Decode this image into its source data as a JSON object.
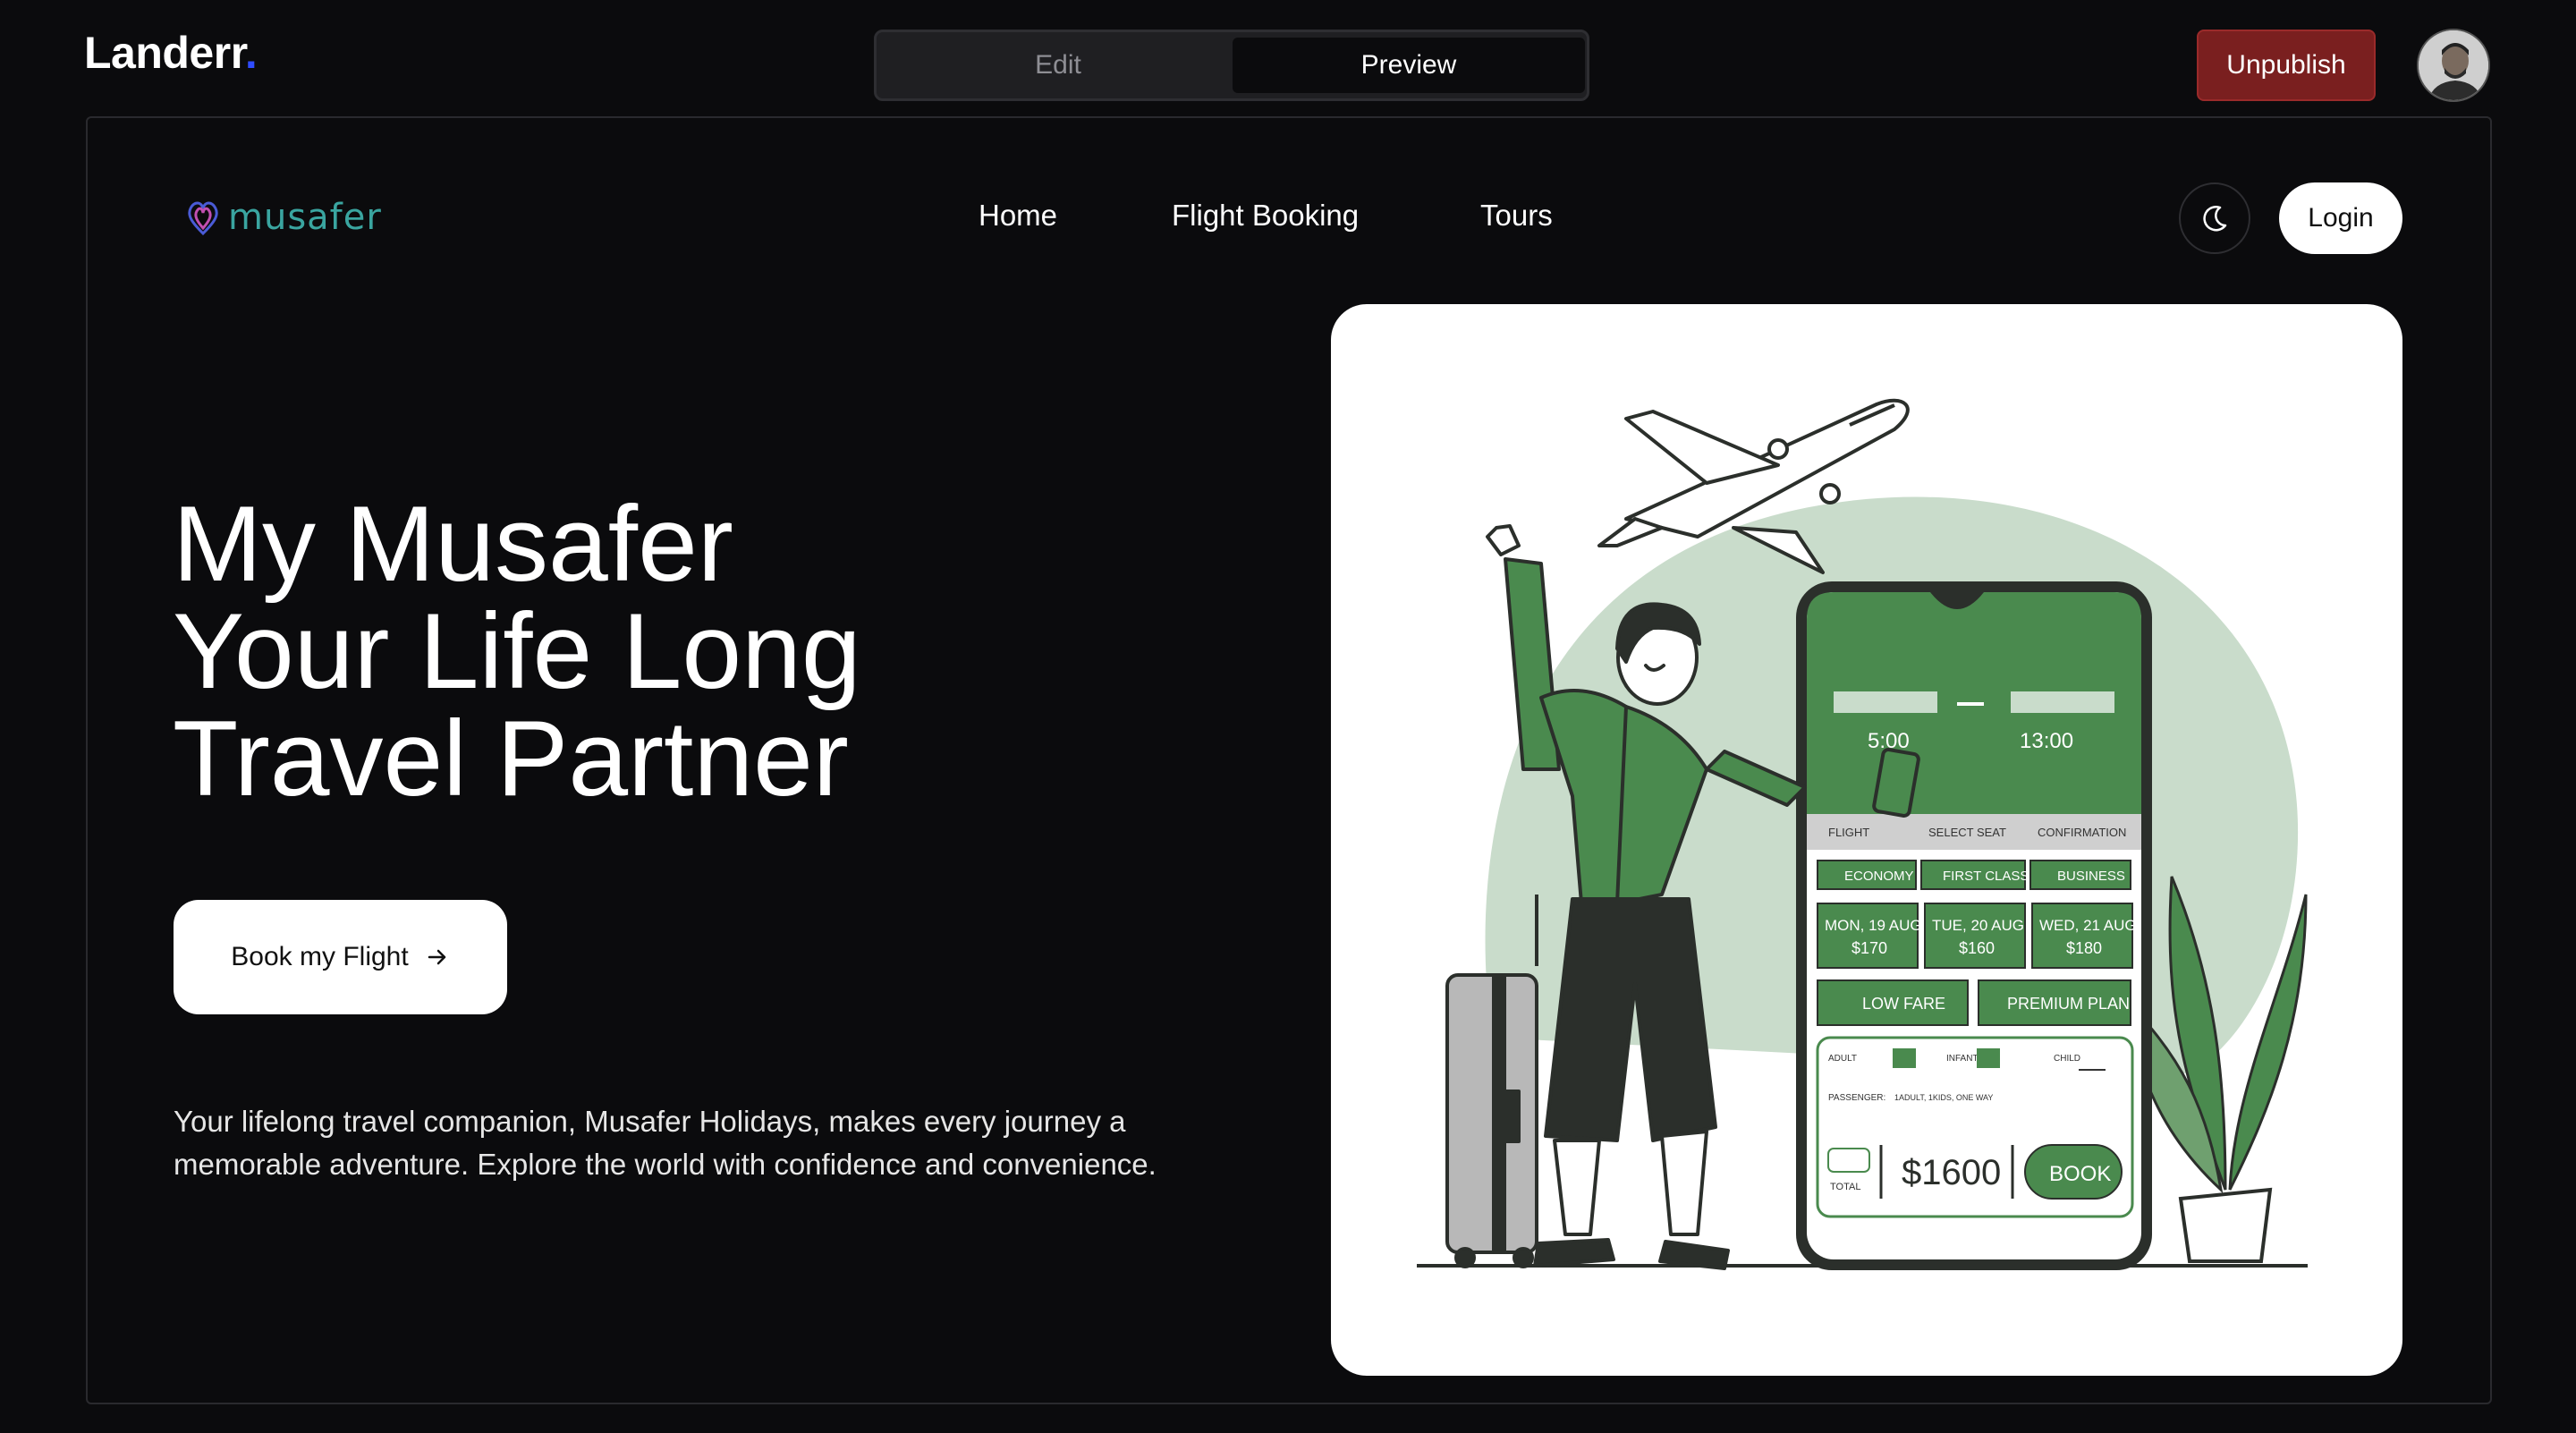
{
  "app": {
    "brand": "Landerr",
    "brand_dot": "."
  },
  "mode_toggle": {
    "edit_label": "Edit",
    "preview_label": "Preview",
    "selected": "Preview"
  },
  "actions": {
    "unpublish_label": "Unpublish"
  },
  "site": {
    "logo_text": "musafer",
    "nav": {
      "home": "Home",
      "flight_booking": "Flight Booking",
      "tours": "Tours"
    },
    "login_label": "Login",
    "icons": {
      "theme": "moon-icon",
      "cta_arrow": "arrow-right-icon"
    },
    "hero": {
      "title_line1": "My Musafer",
      "title_line2": "Your Life Long",
      "title_line3": "Travel Partner",
      "cta_label": "Book my Flight",
      "description": "Your lifelong travel companion, Musafer Holidays, makes every journey a memorable adventure. Explore the world with confidence and convenience."
    },
    "illustration": {
      "time_depart": "5:00",
      "time_arrive": "13:00",
      "steps": [
        "FLIGHT",
        "SELECT SEAT",
        "CONFIRMATION"
      ],
      "classes": [
        "ECONOMY",
        "FIRST CLASS",
        "BUSINESS"
      ],
      "dates": [
        {
          "day": "MON, 19 AUG",
          "price": "$170"
        },
        {
          "day": "TUE, 20 AUG",
          "price": "$160"
        },
        {
          "day": "WED, 21 AUG",
          "price": "$180"
        }
      ],
      "plans": [
        "LOW FARE",
        "PREMIUM PLAN"
      ],
      "pax": [
        "ADULT",
        "INFANT",
        "CHILD"
      ],
      "passenger_label": "PASSENGER:",
      "passenger_value": "1ADULT, 1KIDS, ONE WAY",
      "total_label": "TOTAL",
      "total_value": "$1600",
      "book_label": "BOOK"
    }
  },
  "colors": {
    "accent_green": "#4a8a4e",
    "unpublish_red": "#7a1f1f",
    "brand_blue": "#2f4cff",
    "logo_teal": "#3aa5a0"
  }
}
